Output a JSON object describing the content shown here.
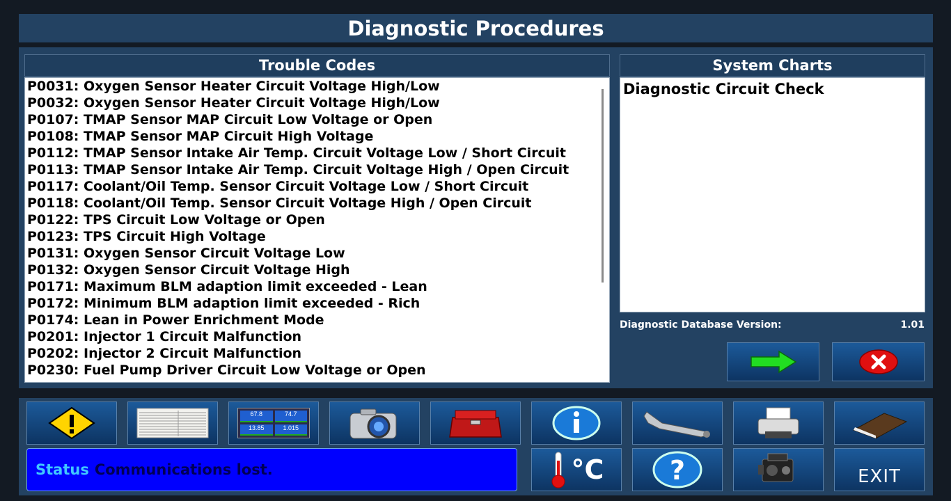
{
  "title": "Diagnostic Procedures",
  "trouble_codes": {
    "header": "Trouble Codes",
    "items": [
      "P0031: Oxygen Sensor Heater Circuit Voltage High/Low",
      "P0032: Oxygen Sensor Heater Circuit Voltage High/Low",
      "P0107: TMAP Sensor MAP Circuit Low Voltage or Open",
      "P0108: TMAP Sensor MAP Circuit High Voltage",
      "P0112: TMAP Sensor Intake Air Temp. Circuit Voltage Low / Short Circuit",
      "P0113: TMAP Sensor Intake Air Temp. Circuit Voltage High / Open Circuit",
      "P0117: Coolant/Oil Temp. Sensor Circuit Voltage Low / Short Circuit",
      "P0118: Coolant/Oil Temp. Sensor Circuit Voltage High / Open Circuit",
      "P0122: TPS Circuit Low Voltage or Open",
      "P0123: TPS Circuit High Voltage",
      "P0131: Oxygen Sensor Circuit Voltage Low",
      "P0132: Oxygen Sensor Circuit Voltage High",
      "P0171: Maximum BLM adaption limit exceeded - Lean",
      "P0172: Minimum BLM adaption limit exceeded - Rich",
      "P0174: Lean in Power Enrichment Mode",
      "P0201: Injector 1 Circuit Malfunction",
      "P0202: Injector 2 Circuit Malfunction",
      "P0230: Fuel Pump Driver Circuit Low Voltage or Open"
    ]
  },
  "system_charts": {
    "header": "System Charts",
    "items": [
      "Diagnostic Circuit Check"
    ]
  },
  "db_version": {
    "label": "Diagnostic Database Version:",
    "value": "1.01"
  },
  "mini_gauges": [
    "67.8",
    "74.7",
    "13.85",
    "1.015"
  ],
  "temp_unit": "°C",
  "exit_label": "EXIT",
  "status": {
    "label": "Status",
    "message": "Communications lost."
  },
  "colors": {
    "panel": "#234262",
    "header": "#1f3e5e",
    "status_bg": "#0000ff",
    "status_label": "#40c8ff"
  }
}
